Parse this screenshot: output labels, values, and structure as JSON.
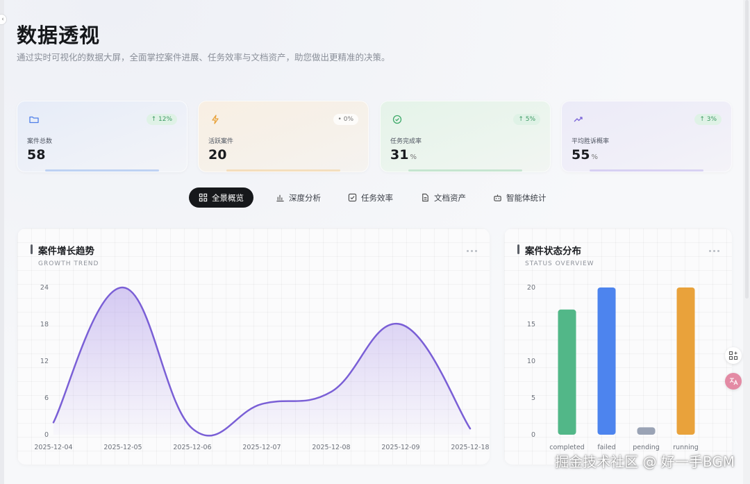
{
  "page": {
    "title": "数据透视",
    "subtitle": "通过实时可视化的数据大屏，全面掌控案件进展、任务效率与文档资产，助您做出更精准的决策。"
  },
  "stats": [
    {
      "label": "案件总数",
      "value": "58",
      "unit": "",
      "trend": "↑ 12%",
      "icon": "folder-icon",
      "color": "#4d7ee8"
    },
    {
      "label": "活跃案件",
      "value": "20",
      "unit": "",
      "trend": "• 0%",
      "icon": "lightning-icon",
      "color": "#e8a23a"
    },
    {
      "label": "任务完成率",
      "value": "31",
      "unit": "%",
      "trend": "↑ 5%",
      "icon": "check-circle-icon",
      "color": "#3faa6a"
    },
    {
      "label": "平均胜诉概率",
      "value": "55",
      "unit": "%",
      "trend": "↑ 3%",
      "icon": "trend-up-icon",
      "color": "#7a63d8"
    }
  ],
  "tabs": [
    {
      "label": "全景概览",
      "icon": "grid-icon",
      "active": true
    },
    {
      "label": "深度分析",
      "icon": "bar-chart-icon",
      "active": false
    },
    {
      "label": "任务效率",
      "icon": "checkbox-icon",
      "active": false
    },
    {
      "label": "文档资产",
      "icon": "document-icon",
      "active": false
    },
    {
      "label": "智能体统计",
      "icon": "robot-icon",
      "active": false
    }
  ],
  "growth_panel": {
    "title": "案件增长趋势",
    "subtitle": "GROWTH TREND"
  },
  "status_panel": {
    "title": "案件状态分布",
    "subtitle": "STATUS OVERVIEW"
  },
  "watermark": "掘金技术社区 @ 好一手BGM",
  "chart_data": [
    {
      "type": "area",
      "title": "案件增长趋势",
      "x": [
        "2025-12-04",
        "2025-12-05",
        "2025-12-06",
        "2025-12-07",
        "2025-12-08",
        "2025-12-09",
        "2025-12-18"
      ],
      "values": [
        2,
        24,
        1,
        5,
        7,
        18,
        1
      ],
      "ylim": [
        0,
        24
      ],
      "yticks": [
        0,
        6,
        12,
        18,
        24
      ],
      "color": "#7a5fd6",
      "grid": false
    },
    {
      "type": "bar",
      "title": "案件状态分布",
      "categories": [
        "completed",
        "failed",
        "pending",
        "running"
      ],
      "values": [
        17,
        20,
        1,
        20
      ],
      "colors": [
        "#52b788",
        "#4d84ee",
        "#9aa3b5",
        "#e9a23b"
      ],
      "ylim": [
        0,
        20
      ],
      "yticks": [
        0,
        5,
        10,
        15,
        20
      ],
      "grid": false
    }
  ]
}
